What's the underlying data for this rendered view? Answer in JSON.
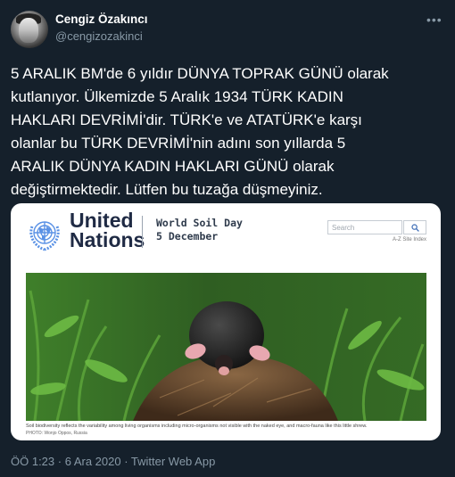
{
  "author": {
    "name": "Cengiz Özakıncı",
    "handle": "@cengizozakinci"
  },
  "menu_label": "•••",
  "tweet_lines": [
    "5 ARALIK BM'de 6 yıldır DÜNYA TOPRAK GÜNÜ olarak",
    "kutlanıyor. Ülkemizde 5 Aralık 1934 TÜRK KADIN",
    "HAKLARI DEVRİMİ'dir. TÜRK'e ve ATATÜRK'e karşı",
    "olanlar bu TÜRK DEVRİMİ'nin adını son yıllarda 5",
    "ARALIK DÜNYA KADIN HAKLARI GÜNÜ olarak",
    "değiştirmektedir. Lütfen bu tuzağa düşmeyiniz."
  ],
  "card": {
    "org_line1": "United",
    "org_line2": "Nations",
    "event_title": "World Soil Day",
    "event_date": "5 December",
    "search_placeholder": "Search",
    "az_index": "A-Z Site Index",
    "caption": "Soil biodiversity reflects the variability among living organisms including micro-organisms not visible with the naked eye, and macro-fauna like this little shrew.",
    "photo_credit": "PHOTO: Wonjo Oppos, Russia"
  },
  "meta": "ÖÖ 1:23 · 6 Ara 2020 · Twitter Web App",
  "colors": {
    "background": "#15202b",
    "secondary_text": "#8899a6",
    "un_blue": "#5b92e5"
  }
}
